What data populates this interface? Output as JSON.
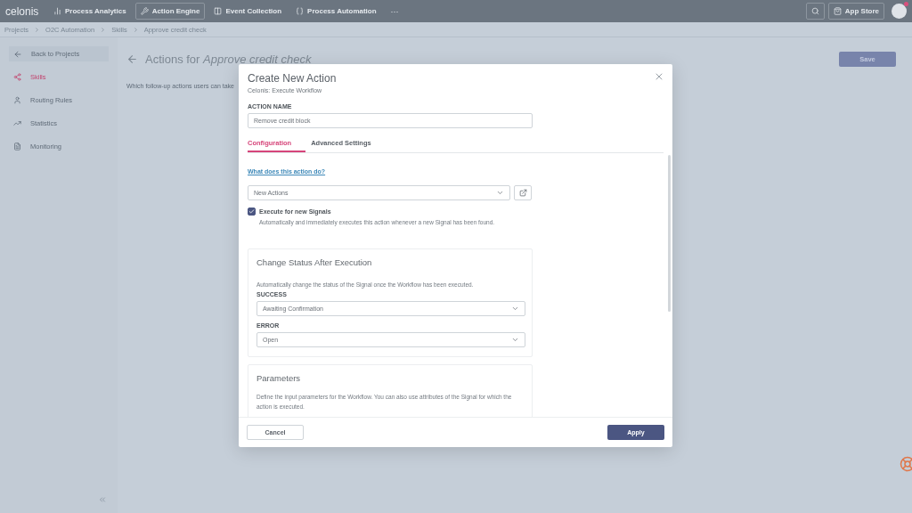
{
  "topbar": {
    "logo": "celonis",
    "nav": [
      {
        "label": "Process Analytics",
        "selected": false
      },
      {
        "label": "Action Engine",
        "selected": true
      },
      {
        "label": "Event Collection",
        "selected": false
      },
      {
        "label": "Process Automation",
        "selected": false
      }
    ],
    "more": "···",
    "app_store": "App Store"
  },
  "breadcrumb": [
    "Projects",
    "O2C Automation",
    "Skills",
    "Approve credit check"
  ],
  "sidebar": {
    "back": "Back to Projects",
    "items": [
      {
        "label": "Skills",
        "selected": true
      },
      {
        "label": "Routing Rules",
        "selected": false
      },
      {
        "label": "Statistics",
        "selected": false
      },
      {
        "label": "Monitoring",
        "selected": false
      }
    ]
  },
  "main": {
    "title_prefix": "Actions for ",
    "title_subject": "Approve credit check",
    "subtitle": "Which follow-up actions users can take",
    "save": "Save"
  },
  "dialog": {
    "title": "Create New Action",
    "subtitle": "Celonis: Execute Workflow",
    "name_label": "ACTION NAME",
    "name_value": "Remove credit block",
    "tabs": [
      {
        "label": "Configuration",
        "selected": true
      },
      {
        "label": "Advanced Settings",
        "selected": false
      }
    ],
    "help_link": "What does this action do?",
    "workflow_select": "New Actions",
    "execute": {
      "label": "Execute for new Signals",
      "description": "Automatically and immediately executes this action whenever a new Signal has been found.",
      "checked": true
    },
    "status_card": {
      "title": "Change Status After Execution",
      "description": "Automatically change the status of the Signal once the Workflow has been executed.",
      "fields": [
        {
          "label": "SUCCESS",
          "value": "Awaiting Confirmation"
        },
        {
          "label": "ERROR",
          "value": "Open"
        }
      ]
    },
    "parameters_card": {
      "title": "Parameters",
      "description": "Define the input parameters for the Workflow. You can also use attributes of the Signal for which the action is executed."
    },
    "cancel": "Cancel",
    "apply": "Apply"
  }
}
